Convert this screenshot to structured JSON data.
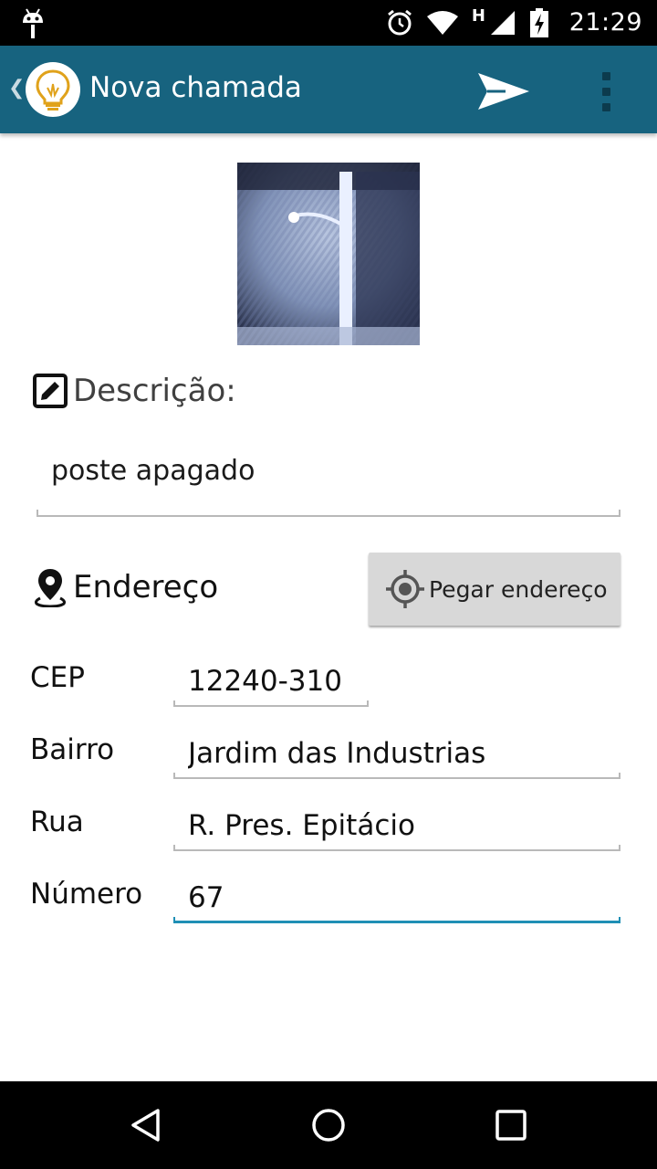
{
  "status_bar": {
    "time": "21:29",
    "network_type": "H"
  },
  "action_bar": {
    "title": "Nova chamada"
  },
  "description": {
    "heading": "Descrição:",
    "value": "poste apagado"
  },
  "address": {
    "heading": "Endereço",
    "get_address_button": "Pegar endereço",
    "fields": {
      "cep": {
        "label": "CEP",
        "value": "12240-310"
      },
      "bairro": {
        "label": "Bairro",
        "value": "Jardim das Industrias"
      },
      "rua": {
        "label": "Rua",
        "value": "R. Pres. Epitácio"
      },
      "numero": {
        "label": "Número",
        "value": "67"
      }
    }
  },
  "colors": {
    "action_bar": "#17637f",
    "focus_underline": "#1f8fb5",
    "button_bg": "#d8d8d8"
  },
  "icons": [
    "android-icon",
    "alarm-icon",
    "wifi-icon",
    "signal-icon",
    "battery-icon",
    "lightbulb-logo",
    "send-icon",
    "overflow-icon",
    "edit-icon",
    "location-pin-icon",
    "gps-target-icon",
    "back-icon",
    "home-icon",
    "recents-icon"
  ]
}
